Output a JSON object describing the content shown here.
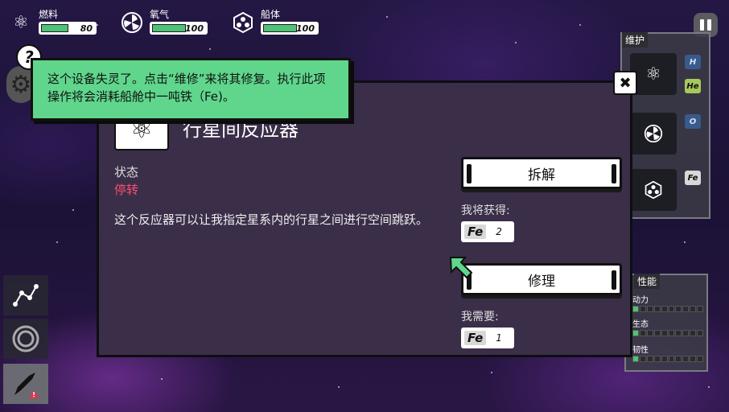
{
  "resources": [
    {
      "label": "燃料",
      "value": "80",
      "fill_fraction": 0.8,
      "icon": "atom-icon"
    },
    {
      "label": "氧气",
      "value": "100",
      "fill_fraction": 1.0,
      "icon": "fan-icon"
    },
    {
      "label": "船体",
      "value": "100",
      "fill_fraction": 1.0,
      "icon": "hull-icon"
    }
  ],
  "tooltip": {
    "text": "这个设备失灵了。点击“维修”来将其修复。执行此项操作将会消耗船舱中一吨铁（Fe)。"
  },
  "dialog": {
    "title": "行星间反应器",
    "status_label": "状态",
    "status_value": "停转",
    "description": "这个反应器可以让我指定星系内的行星之间进行空间跳跃。",
    "dismantle_label": "拆解",
    "gain_label": "我将获得:",
    "gain_element": "Fe",
    "gain_qty": "2",
    "repair_label": "修理",
    "need_label": "我需要:",
    "need_element": "Fe",
    "need_qty": "1"
  },
  "maintenance": {
    "header": "维护",
    "slots": [
      {
        "icon": "atom-icon",
        "tags": [
          "H",
          "He"
        ]
      },
      {
        "icon": "fan-icon",
        "tags": [
          "O"
        ]
      },
      {
        "icon": "hull-icon",
        "tags": [
          "Fe"
        ]
      }
    ]
  },
  "performance": {
    "header": "性能",
    "rows": [
      {
        "label": "动力",
        "level_fraction": 0.1
      },
      {
        "label": "生态",
        "level_fraction": 0.1
      },
      {
        "label": "韧性",
        "level_fraction": 0.1
      }
    ]
  },
  "colors": {
    "accent_green": "#5fd68c",
    "status_red": "#ff4f6e",
    "bar_green": "#4fc277"
  }
}
